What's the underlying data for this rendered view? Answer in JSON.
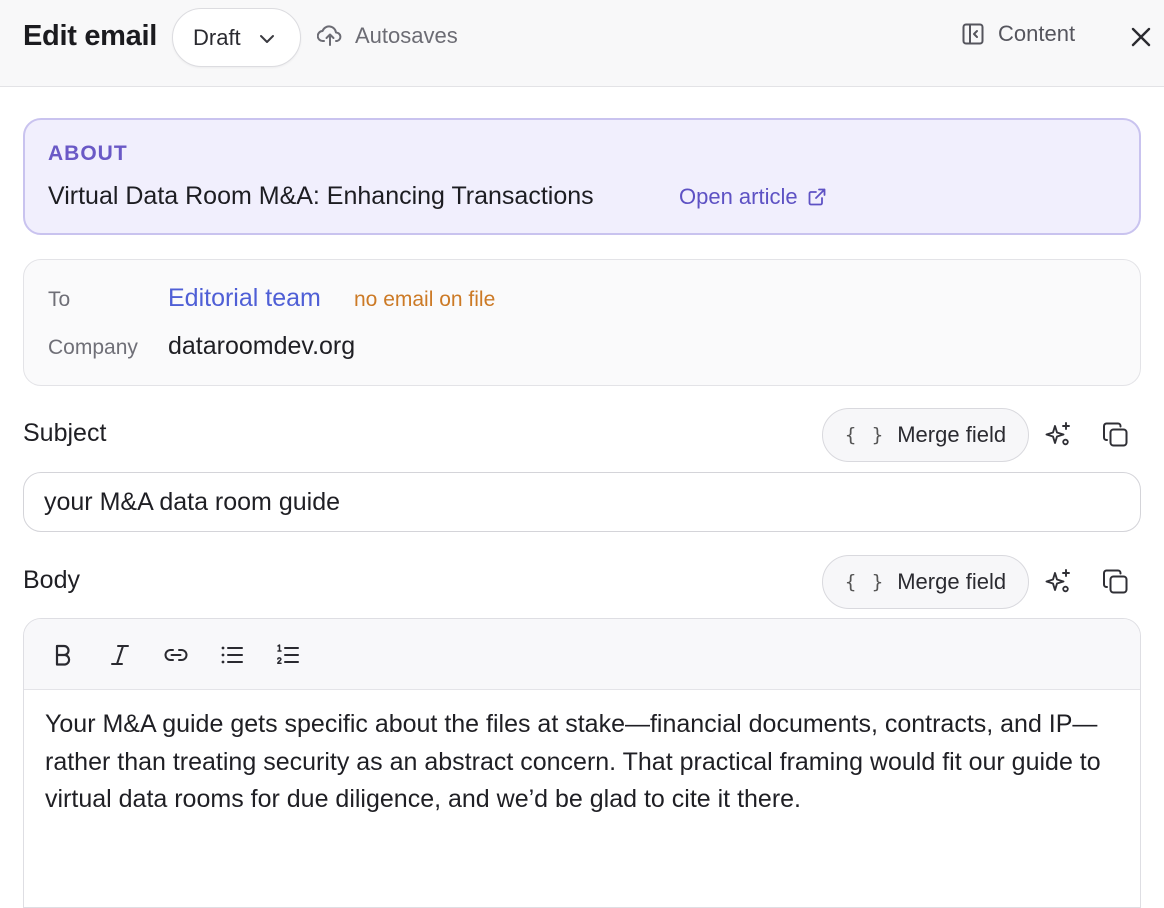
{
  "header": {
    "title": "Edit email",
    "status": "Draft",
    "autosave_label": "Autosaves",
    "content_label": "Content"
  },
  "about": {
    "label": "ABOUT",
    "title": "Virtual Data Room M&A: Enhancing Transactions",
    "link_label": "Open article"
  },
  "recipient": {
    "to_label": "To",
    "to_value": "Editorial team",
    "to_note": "no email on file",
    "company_label": "Company",
    "company_value": "dataroomdev.org"
  },
  "subject": {
    "label": "Subject",
    "merge_label": "Merge field",
    "merge_glyph": "{ }",
    "value": "your M&A data room guide"
  },
  "body": {
    "label": "Body",
    "merge_label": "Merge field",
    "merge_glyph": "{ }",
    "toolbar": [
      "bold",
      "italic",
      "link",
      "bulleted-list",
      "numbered-list"
    ],
    "text": "Your M&A guide gets specific about the files at stake—financial documents, contracts, and IP—rather than treating security as an abstract concern. That practical framing would fit our guide to virtual data rooms for due diligence, and we’d be glad to cite it there."
  },
  "colors": {
    "accent": "#6a59c6",
    "link": "#4f5fd6",
    "warning": "#cc7a26",
    "about_bg": "#f1effd"
  }
}
